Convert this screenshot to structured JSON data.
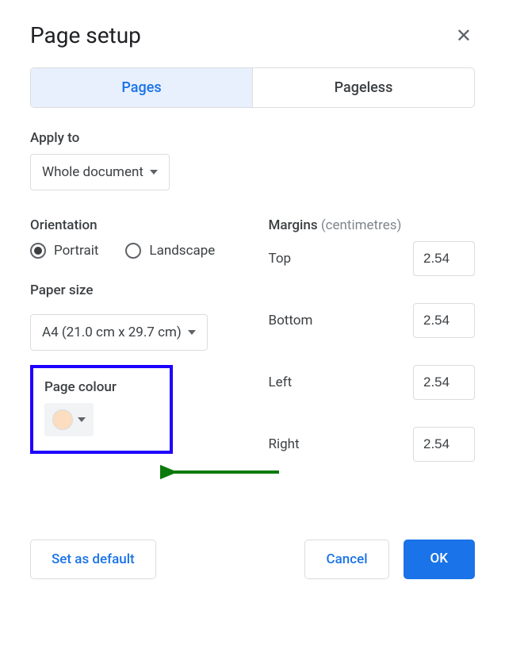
{
  "dialog": {
    "title": "Page setup"
  },
  "tabs": {
    "pages": "Pages",
    "pageless": "Pageless"
  },
  "applyTo": {
    "label": "Apply to",
    "value": "Whole document"
  },
  "orientation": {
    "label": "Orientation",
    "portrait": "Portrait",
    "landscape": "Landscape",
    "selected": "portrait"
  },
  "paperSize": {
    "label": "Paper size",
    "value": "A4 (21.0 cm x 29.7 cm)"
  },
  "pageColour": {
    "label": "Page colour",
    "swatch": "#fcddc0"
  },
  "margins": {
    "label": "Margins",
    "unit": "(centimetres)",
    "top": {
      "label": "Top",
      "value": "2.54"
    },
    "bottom": {
      "label": "Bottom",
      "value": "2.54"
    },
    "left": {
      "label": "Left",
      "value": "2.54"
    },
    "right": {
      "label": "Right",
      "value": "2.54"
    }
  },
  "buttons": {
    "setDefault": "Set as default",
    "cancel": "Cancel",
    "ok": "OK"
  }
}
